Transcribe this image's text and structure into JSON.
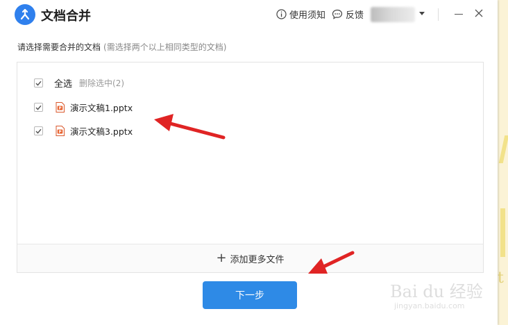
{
  "app": {
    "title": "文档合并",
    "accent": "#2f80ed"
  },
  "titlebar": {
    "help_label": "使用须知",
    "feedback_label": "反馈"
  },
  "instruction": {
    "main": "请选择需要合并的文档",
    "hint": "(需选择两个以上相同类型的文档)"
  },
  "list": {
    "select_all_label": "全选",
    "delete_selected_label": "删除选中(2)",
    "files": [
      {
        "name": "演示文稿1.pptx",
        "checked": true
      },
      {
        "name": "演示文稿3.pptx",
        "checked": true
      }
    ],
    "add_more_label": "添加更多文件"
  },
  "actions": {
    "next_label": "下一步",
    "next_color": "#2e8ae6"
  },
  "annotations": {
    "arrow_color": "#e02424"
  },
  "watermark": {
    "main": "Bai du 经验",
    "sub": "jingyan.baidu.com"
  },
  "icons": [
    "app-logo-icon",
    "info-icon",
    "feedback-icon",
    "caret-down-icon",
    "minimize-icon",
    "close-icon",
    "check-icon",
    "pptx-file-icon",
    "plus-icon"
  ]
}
